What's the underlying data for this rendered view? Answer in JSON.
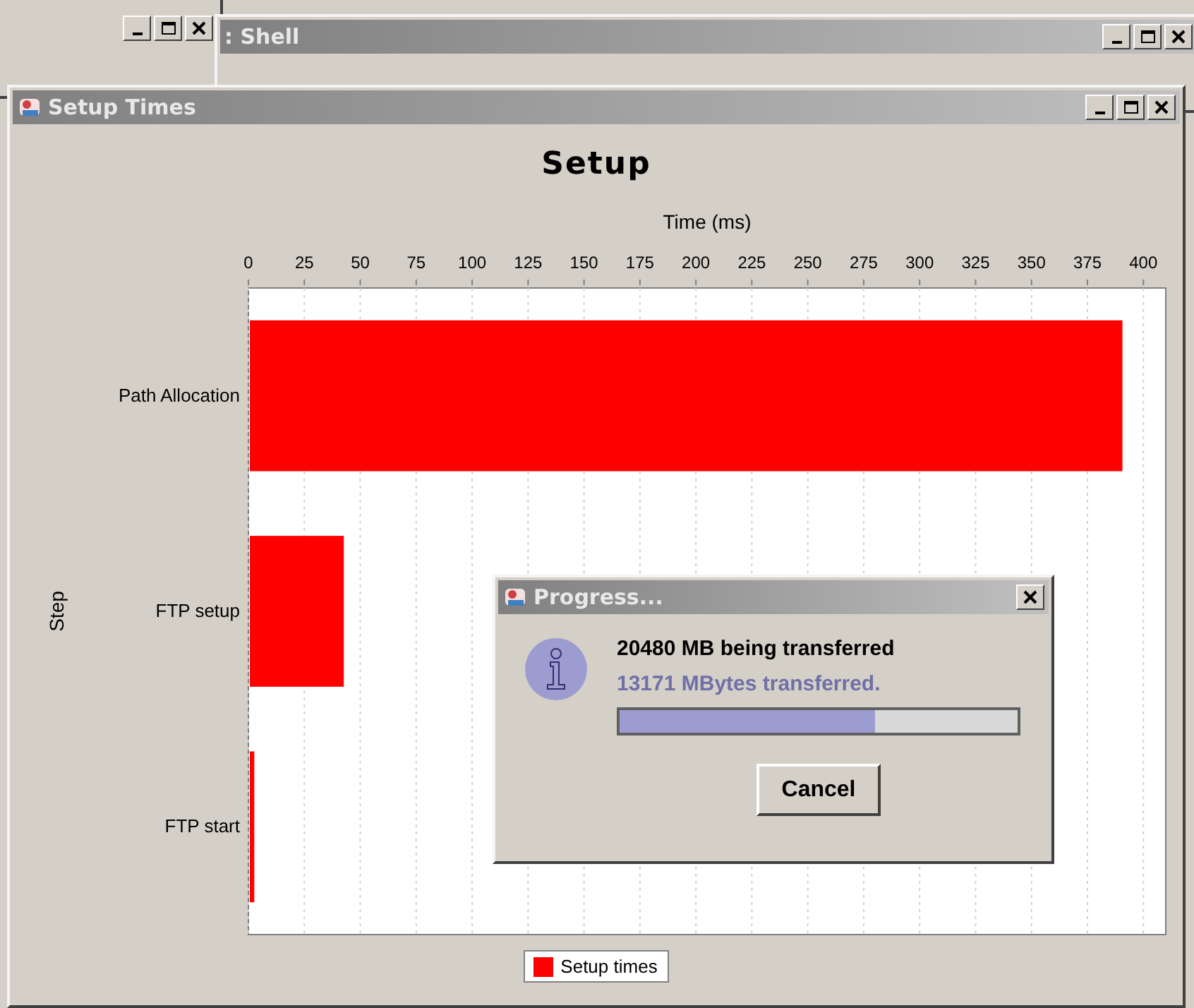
{
  "background_windows": [
    {
      "kind": "plain"
    },
    {
      "kind": "titled",
      "title": ": Shell"
    }
  ],
  "window": {
    "title": "Setup Times"
  },
  "chart": {
    "chart_data": {
      "type": "bar",
      "orientation": "horizontal",
      "title": "Setup",
      "xlabel": "Time (ms)",
      "ylabel": "Step",
      "categories": [
        "Path Allocation",
        "FTP setup",
        "FTP start"
      ],
      "series": [
        {
          "name": "Setup times",
          "color": "#ff0000",
          "values": [
            390,
            42,
            2
          ]
        }
      ],
      "xlim": [
        0,
        410
      ],
      "grid": true,
      "xticks": [
        0,
        25,
        50,
        75,
        100,
        125,
        150,
        175,
        200,
        225,
        250,
        275,
        300,
        325,
        350,
        375,
        400
      ]
    }
  },
  "dialog": {
    "title": "Progress...",
    "message": "20480 MB being transferred",
    "detail": "13171 MBytes transferred.",
    "level": 0.643,
    "button": "Cancel"
  }
}
